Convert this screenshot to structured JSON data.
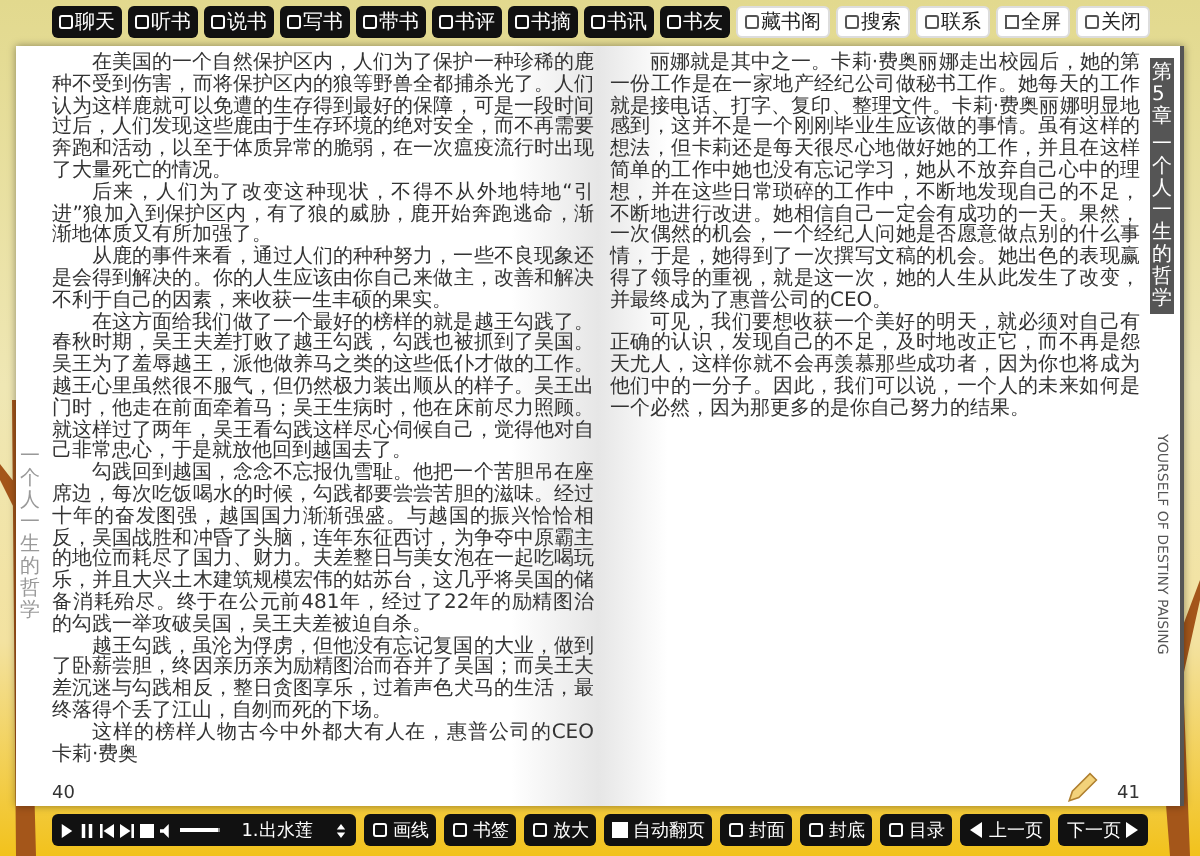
{
  "top_toolbar": {
    "dark_buttons": [
      {
        "label": "聊天"
      },
      {
        "label": "听书"
      },
      {
        "label": "说书"
      },
      {
        "label": "写书"
      },
      {
        "label": "带书"
      },
      {
        "label": "书评"
      },
      {
        "label": "书摘"
      },
      {
        "label": "书讯"
      },
      {
        "label": "书友"
      }
    ],
    "light_buttons": [
      {
        "label": "藏书阁",
        "kind": "icon"
      },
      {
        "label": "搜索",
        "kind": "icon"
      },
      {
        "label": "联系",
        "kind": "icon"
      },
      {
        "label": "全屏",
        "kind": "checkbox",
        "checked": false
      },
      {
        "label": "关闭",
        "kind": "icon"
      }
    ]
  },
  "left_page": {
    "side_label": "一个人一生的哲学",
    "paragraphs": [
      "在美国的一个自然保护区内，人们为了保护一种珍稀的鹿种不受到伤害，而将保护区内的狼等野兽全都捕杀光了。人们认为这样鹿就可以免遭的生存得到最好的保障，可是一段时间过后，人们发现这些鹿由于生存环境的绝对安全，而不再需要奔跑和活动，以至于体质异常的脆弱，在一次瘟疫流行时出现了大量死亡的情况。",
      "后来，人们为了改变这种现状，不得不从外地特地“引进”狼加入到保护区内，有了狼的威胁，鹿开始奔跑逃命，渐渐地体质又有所加强了。",
      "从鹿的事件来看，通过人们的种种努力，一些不良现象还是会得到解决的。你的人生应该由你自己来做主，改善和解决不利于自己的因素，来收获一生丰硕的果实。",
      "在这方面给我们做了一个最好的榜样的就是越王勾践了。春秋时期，吴王夫差打败了越王勾践，勾践也被抓到了吴国。吴王为了羞辱越王，派他做养马之类的这些低仆才做的工作。越王心里虽然很不服气，但仍然极力装出顺从的样子。吴王出门时，他走在前面牵着马；吴王生病时，他在床前尽力照顾。就这样过了两年，吴王看勾践这样尽心伺候自己，觉得他对自己非常忠心，于是就放他回到越国去了。",
      "勾践回到越国，念念不忘报仇雪耻。他把一个苦胆吊在座席边，每次吃饭喝水的时候，勾践都要尝尝苦胆的滋味。经过十年的奋发图强，越国国力渐渐强盛。与越国的振兴恰恰相反，吴国战胜和冲昏了头脑，连年东征西讨，为争夺中原霸主的地位而耗尽了国力、财力。夫差整日与美女泡在一起吃喝玩乐，并且大兴土木建筑规模宏伟的姑苏台，这几乎将吴国的储备消耗殆尽。终于在公元前481年，经过了22年的励精图治的勾践一举攻破吴国，吴王夫差被迫自杀。",
      "越王勾践，虽沦为俘虏，但他没有忘记复国的大业，做到了卧薪尝胆，终因亲历亲为励精图治而吞并了吴国；而吴王夫差沉迷与勾践相反，整日贪图享乐，过着声色犬马的生活，最终落得个丢了江山，自刎而死的下场。",
      "这样的榜样人物古今中外都大有人在，惠普公司的CEO卡莉·费奥"
    ],
    "page_number": "40"
  },
  "right_page": {
    "chapter_tab": [
      "第5章",
      "一个人一生的哲学"
    ],
    "side_caption": "YOURSELF OF DESTINY PAISING",
    "paragraphs": [
      "丽娜就是其中之一。卡莉·费奥丽娜走出校园后，她的第一份工作是在一家地产经纪公司做秘书工作。她每天的工作就是接电话、打字、复印、整理文件。卡莉·费奥丽娜明显地感到，这并不是一个刚刚毕业生应该做的事情。虽有这样的想法，但卡莉还是每天很尽心地做好她的工作，并且在这样简单的工作中她也没有忘记学习，她从不放弃自己心中的理想，并在这些日常琐碎的工作中，不断地发现自己的不足，不断地进行改进。她相信自己一定会有成功的一天。果然，一次偶然的机会，一个经纪人问她是否愿意做点别的什么事情，于是，她得到了一次撰写文稿的机会。她出色的表现赢得了领导的重视，就是这一次，她的人生从此发生了改变，并最终成为了惠普公司的CEO。",
      "可见，我们要想收获一个美好的明天，就必须对自己有正确的认识，发现自己的不足，及时地改正它，而不再是怨天尤人，这样你就不会再羡慕那些成功者，因为你也将成为他们中的一分子。因此，我们可以说，一个人的未来如何是一个必然，因为那更多的是你自己努力的结果。"
    ],
    "page_number": "41"
  },
  "bottom_toolbar": {
    "volume": {
      "level": 0.95
    },
    "track": "1.出水莲",
    "buttons": [
      {
        "label": "画线",
        "kind": "icon"
      },
      {
        "label": "书签",
        "kind": "icon"
      },
      {
        "label": "放大",
        "kind": "icon"
      },
      {
        "label": "自动翻页",
        "kind": "checkbox",
        "checked": false
      },
      {
        "label": "封面",
        "kind": "icon"
      },
      {
        "label": "封底",
        "kind": "icon"
      },
      {
        "label": "目录",
        "kind": "icon"
      },
      {
        "label": "上一页",
        "kind": "prev"
      },
      {
        "label": "下一页",
        "kind": "next"
      }
    ]
  }
}
